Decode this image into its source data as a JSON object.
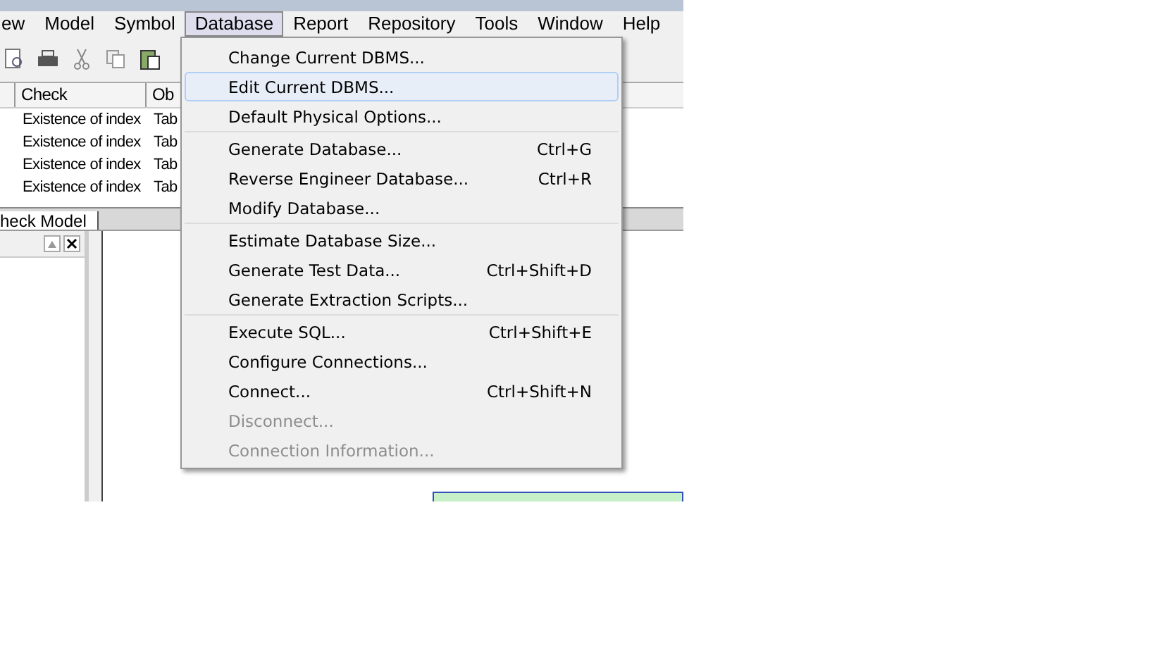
{
  "menubar": [
    {
      "label": "ew",
      "selected": false
    },
    {
      "label": "Model",
      "selected": false
    },
    {
      "label": "Symbol",
      "selected": false
    },
    {
      "label": "Database",
      "selected": true
    },
    {
      "label": "Report",
      "selected": false
    },
    {
      "label": "Repository",
      "selected": false
    },
    {
      "label": "Tools",
      "selected": false
    },
    {
      "label": "Window",
      "selected": false
    },
    {
      "label": "Help",
      "selected": false
    }
  ],
  "result_list": {
    "columns": [
      "Check",
      "Ob"
    ],
    "rows": [
      [
        "Existence of index",
        "Tab"
      ],
      [
        "Existence of index",
        "Tab"
      ],
      [
        "Existence of index",
        "Tab"
      ],
      [
        "Existence of index",
        "Tab"
      ]
    ]
  },
  "tabs": [
    {
      "label": "heck Model",
      "selected": true
    }
  ],
  "menu": {
    "sections": [
      [
        {
          "label": "Change Current DBMS...",
          "selected": false,
          "disabled": false
        },
        {
          "label": "Edit Current DBMS...",
          "selected": true,
          "disabled": false
        },
        {
          "label": "Default Physical Options...",
          "selected": false,
          "disabled": false
        }
      ],
      [
        {
          "label": "Generate Database...",
          "shortcut": "Ctrl+G",
          "selected": false,
          "disabled": false
        },
        {
          "label": "Reverse Engineer Database...",
          "shortcut": "Ctrl+R",
          "selected": false,
          "disabled": false
        },
        {
          "label": "Modify Database...",
          "selected": false,
          "disabled": false
        }
      ],
      [
        {
          "label": "Estimate Database Size...",
          "selected": false,
          "disabled": false
        },
        {
          "label": "Generate Test Data...",
          "shortcut": "Ctrl+Shift+D",
          "selected": false,
          "disabled": false
        },
        {
          "label": "Generate Extraction Scripts...",
          "selected": false,
          "disabled": false
        }
      ],
      [
        {
          "label": "Execute SQL...",
          "shortcut": "Ctrl+Shift+E",
          "selected": false,
          "disabled": false
        },
        {
          "label": "Configure Connections...",
          "selected": false,
          "disabled": false
        },
        {
          "label": "Connect...",
          "shortcut": "Ctrl+Shift+N",
          "selected": false,
          "disabled": false
        },
        {
          "label": "Disconnect...",
          "selected": false,
          "disabled": true
        },
        {
          "label": "Connection Information...",
          "selected": false,
          "disabled": true
        }
      ]
    ]
  }
}
